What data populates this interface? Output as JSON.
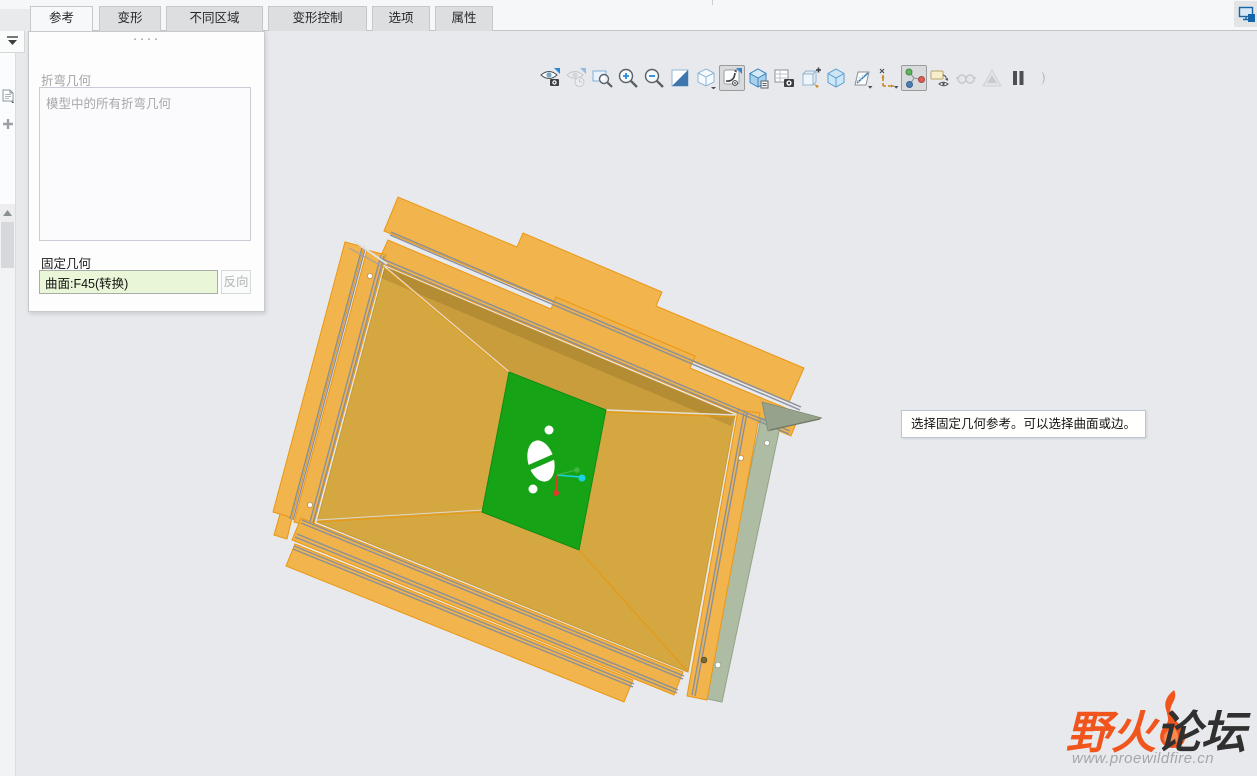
{
  "ribbon": {
    "tabs": [
      {
        "label": "参考",
        "active": true
      },
      {
        "label": "变形",
        "active": false
      },
      {
        "label": "不同区域",
        "active": false
      },
      {
        "label": "变形控制",
        "active": false
      },
      {
        "label": "选项",
        "active": false
      },
      {
        "label": "属性",
        "active": false
      }
    ]
  },
  "dashboard_panel": {
    "drag_handle_dots": "····",
    "bend_geometry": {
      "label": "折弯几何",
      "list_placeholder": "模型中的所有折弯几何"
    },
    "fixed_geometry": {
      "label": "固定几何",
      "value": "曲面:F45(转换)",
      "flip_button": "反向",
      "value_background": "#e9f6d8"
    }
  },
  "graphics_toolbar": {
    "icons": [
      {
        "name": "view-visibility",
        "selected": false,
        "disabled": false
      },
      {
        "name": "image-visibility",
        "selected": false,
        "disabled": true
      },
      {
        "name": "zoom-region",
        "selected": false,
        "disabled": false
      },
      {
        "name": "zoom-in",
        "selected": false,
        "disabled": false
      },
      {
        "name": "zoom-out",
        "selected": false,
        "disabled": false
      },
      {
        "name": "repaint",
        "selected": false,
        "disabled": false
      },
      {
        "name": "display-style",
        "selected": false,
        "disabled": false
      },
      {
        "name": "sheet-bend-preview",
        "selected": true,
        "disabled": false
      },
      {
        "name": "saved-orientations",
        "selected": false,
        "disabled": false
      },
      {
        "name": "view-manager",
        "selected": false,
        "disabled": false
      },
      {
        "name": "annotation-display",
        "selected": false,
        "disabled": false
      },
      {
        "name": "shading-with-edges",
        "selected": false,
        "disabled": false
      },
      {
        "name": "plane-display",
        "selected": false,
        "disabled": false
      },
      {
        "name": "axis-display",
        "selected": false,
        "disabled": false
      },
      {
        "name": "csys-display",
        "selected": true,
        "disabled": false
      },
      {
        "name": "point-display",
        "selected": false,
        "disabled": false
      },
      {
        "name": "3d-glasses",
        "selected": false,
        "disabled": true
      },
      {
        "name": "simulation-display",
        "selected": false,
        "disabled": true
      },
      {
        "name": "pause",
        "selected": false,
        "disabled": false
      },
      {
        "name": "resume",
        "selected": false,
        "disabled": true
      }
    ]
  },
  "left_rail": {
    "icons": [
      "collapse-panel",
      "model-tree-document",
      "add-item"
    ]
  },
  "prompt_tooltip": {
    "text": "选择固定几何参考。可以选择曲面或边。"
  },
  "model_view": {
    "selected_face_color": "#16a316",
    "sheet_flap_color": "#f2b44c",
    "sheet_panel_color": "#d5a740",
    "edge_highlight_color": "#ea9712",
    "bend_line_color": "#8a909a",
    "side_strip_color": "#aebca4",
    "triad_colors": {
      "x": "#e03a2e",
      "y": "#19d2e8",
      "z": "#3eb53e"
    }
  },
  "watermark": {
    "site_name_left": "野火",
    "site_name_right": "论坛",
    "url": "www.proewildfire.cn",
    "accent_color": "#f1551e"
  }
}
